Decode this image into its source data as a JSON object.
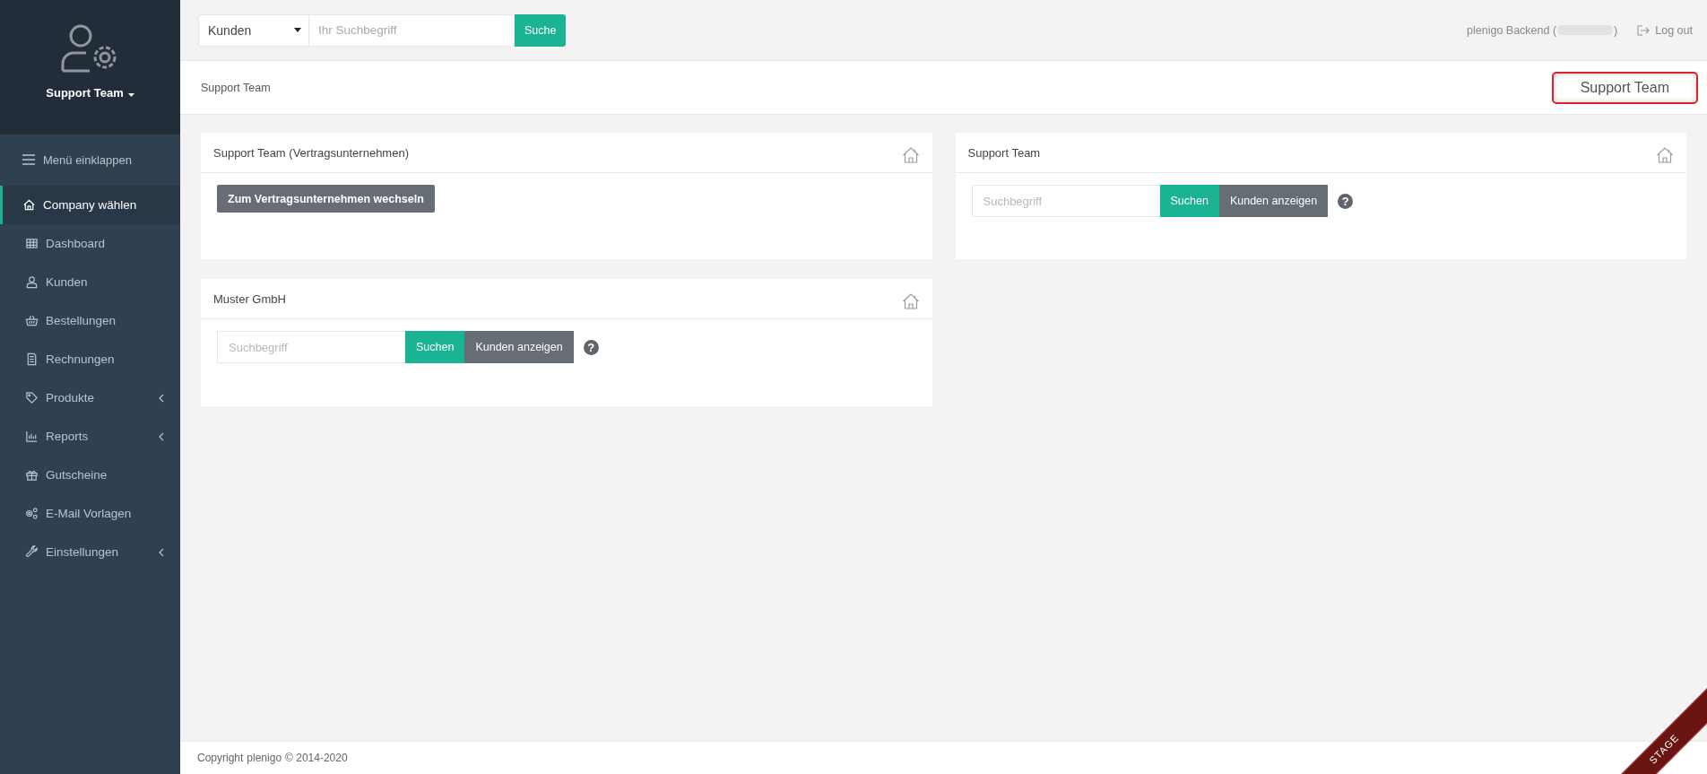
{
  "sidebar": {
    "profile_name": "Support Team",
    "collapse_label": "Menü einklappen",
    "items": [
      {
        "label": "Company wählen",
        "selected": true,
        "has_submenu": false
      },
      {
        "label": "Dashboard",
        "selected": false,
        "has_submenu": false
      },
      {
        "label": "Kunden",
        "selected": false,
        "has_submenu": false
      },
      {
        "label": "Bestellungen",
        "selected": false,
        "has_submenu": false
      },
      {
        "label": "Rechnungen",
        "selected": false,
        "has_submenu": false
      },
      {
        "label": "Produkte",
        "selected": false,
        "has_submenu": true
      },
      {
        "label": "Reports",
        "selected": false,
        "has_submenu": true
      },
      {
        "label": "Gutscheine",
        "selected": false,
        "has_submenu": false
      },
      {
        "label": "E-Mail Vorlagen",
        "selected": false,
        "has_submenu": false
      },
      {
        "label": "Einstellungen",
        "selected": false,
        "has_submenu": true
      }
    ]
  },
  "topbar": {
    "search_scope": "Kunden",
    "search_placeholder": "Ihr Suchbegriff",
    "search_button": "Suche",
    "user_prefix": "plenigo Backend (",
    "user_suffix": ")",
    "logout": "Log out"
  },
  "header": {
    "breadcrumb": "Support Team",
    "company_badge": "Support Team"
  },
  "cards": [
    {
      "kind": "switch",
      "title": "Support Team (Vertragsunternehmen)",
      "button": "Zum Vertragsunternehmen wechseln"
    },
    {
      "kind": "search",
      "title": "Support Team",
      "placeholder": "Suchbegriff",
      "search_button": "Suchen",
      "show_button": "Kunden anzeigen",
      "help": "?"
    },
    {
      "kind": "search",
      "title": "Muster GmbH",
      "placeholder": "Suchbegriff",
      "search_button": "Suchen",
      "show_button": "Kunden anzeigen",
      "help": "?"
    }
  ],
  "footer": {
    "copyright_label": "Copyright",
    "brand": "plenigo",
    "years": "© 2014-2020"
  },
  "ribbon": "STAGE"
}
